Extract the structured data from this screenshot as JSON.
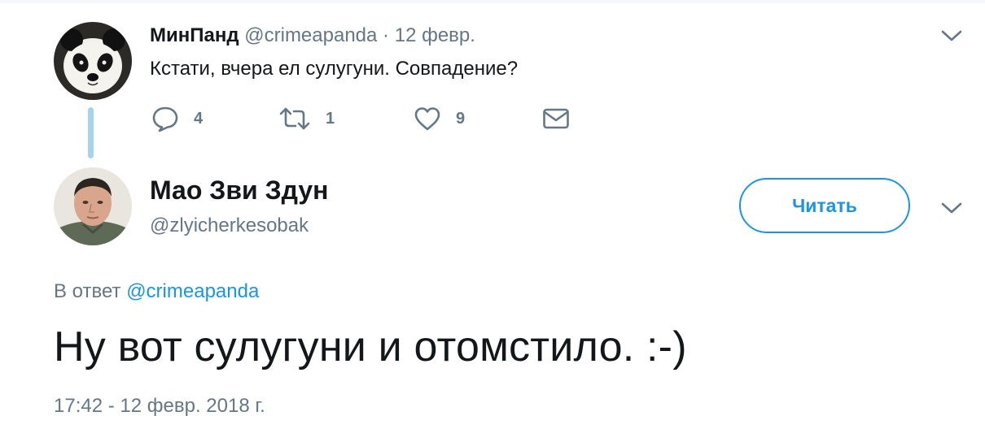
{
  "parent_tweet": {
    "author_name": "МинПанд",
    "author_handle": "@crimeapanda",
    "separator": "·",
    "date": "12 февр.",
    "text": "Кстати, вчера ел сулугуни. Совпадение?",
    "avatar_icon": "panda-avatar",
    "actions": {
      "reply_icon": "reply-icon",
      "reply_count": "4",
      "retweet_icon": "retweet-icon",
      "retweet_count": "1",
      "like_icon": "heart-icon",
      "like_count": "9",
      "dm_icon": "envelope-icon"
    },
    "menu_icon": "chevron-down-icon"
  },
  "main_tweet": {
    "author_name": "Мао Зви Здун",
    "author_handle": "@zlyicherkesobak",
    "avatar_icon": "portrait-avatar",
    "follow_label": "Читать",
    "reply_prefix": "В ответ",
    "reply_mention": "@crimeapanda",
    "text": "Ну вот сулугуни и отомстило. :-)",
    "timestamp": "17:42 - 12 февр. 2018 г.",
    "menu_icon": "chevron-down-icon"
  },
  "colors": {
    "accent": "#1b95e0",
    "secondary_text": "#657786",
    "primary_text": "#14171a",
    "thread_line": "#a7d3ea"
  }
}
